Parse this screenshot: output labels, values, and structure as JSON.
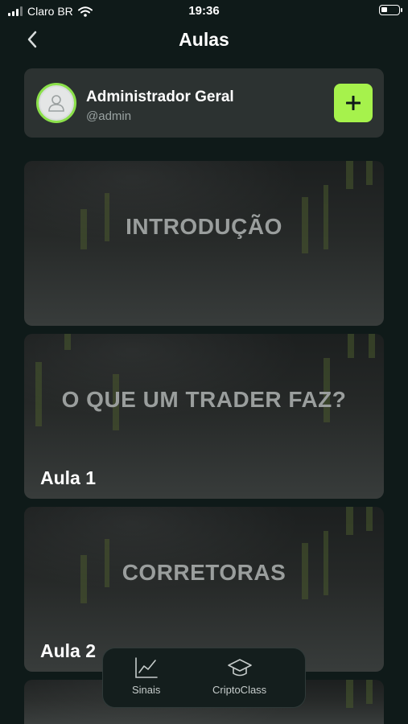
{
  "status_bar": {
    "carrier": "Claro BR",
    "time": "19:36"
  },
  "header": {
    "title": "Aulas",
    "back_icon": "chevron-left-icon"
  },
  "user": {
    "name": "Administrador Geral",
    "handle": "@admin",
    "add_label": "+"
  },
  "lessons": [
    {
      "title": "INTRODUÇÃO",
      "subtitle": ""
    },
    {
      "title": "O QUE UM TRADER FAZ?",
      "subtitle": "Aula 1"
    },
    {
      "title": "CORRETORAS",
      "subtitle": "Aula 2"
    }
  ],
  "tabbar": {
    "tabs": [
      {
        "label": "Sinais",
        "icon": "line-chart-icon"
      },
      {
        "label": "CriptoClass",
        "icon": "graduation-cap-icon"
      }
    ]
  },
  "colors": {
    "accent": "#a6f24c",
    "avatar_ring": "#8be04a",
    "background": "#0f1a19",
    "card": "#2c3231"
  }
}
